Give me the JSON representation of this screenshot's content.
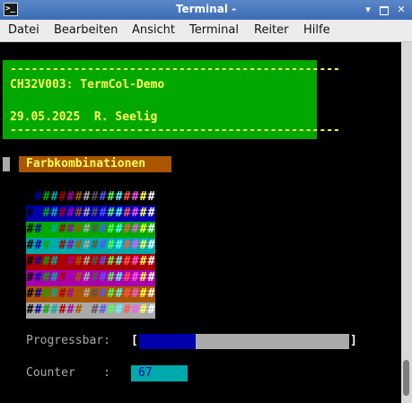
{
  "window": {
    "title": "Terminal -",
    "buttons": {
      "minimize": "▾",
      "close": "✕"
    }
  },
  "menu": [
    "Datei",
    "Bearbeiten",
    "Ansicht",
    "Terminal",
    "Reiter",
    "Hilfe"
  ],
  "banner": {
    "dashes": "-----------------------------------------------",
    "line1": "CH32V003: TermCol-Demo",
    "line2": "29.05.2025  R. Seelig"
  },
  "section_title": "Farbkombinationen",
  "palette": [
    "#000000",
    "#0000aa",
    "#00aa00",
    "#00aaaa",
    "#aa0000",
    "#aa00aa",
    "#aa5500",
    "#aaaaaa",
    "#555555",
    "#5555ff",
    "#55ff55",
    "#55ffff",
    "#ff5555",
    "#ff55ff",
    "#ffff55",
    "#ffffff"
  ],
  "color_matrix": {
    "glyph": "#",
    "rows": 8,
    "cols": 16
  },
  "progress": {
    "label": "Progressbar:",
    "open": "[",
    "close": "]",
    "fraction": 0.27
  },
  "counter": {
    "label": "Counter    :",
    "value": "67"
  }
}
